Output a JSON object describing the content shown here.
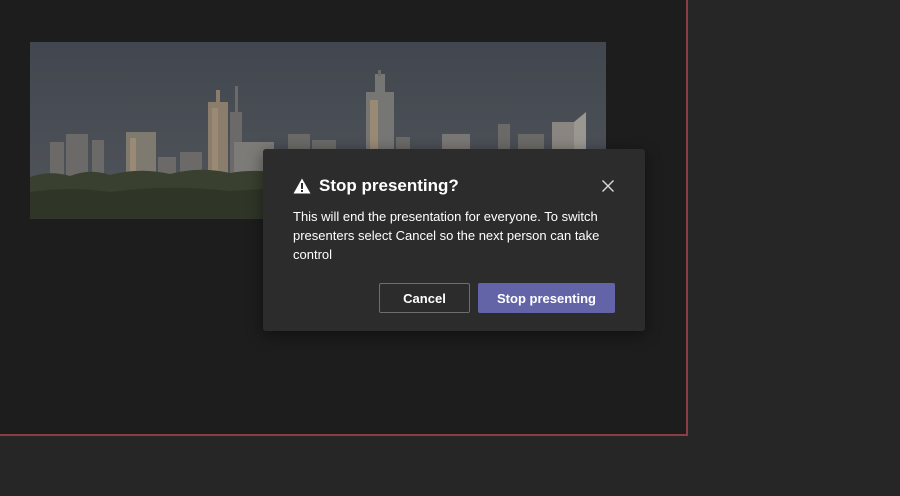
{
  "dialog": {
    "title": "Stop presenting?",
    "message": "This will end the presentation for everyone. To switch presenters select Cancel so the next person can take control",
    "cancel_label": "Cancel",
    "confirm_label": "Stop presenting",
    "icons": {
      "warning": "warning-icon",
      "close": "close-icon"
    }
  },
  "colors": {
    "background": "#262626",
    "presentation_border": "#8a3d45",
    "dialog_background": "#2d2c2c",
    "primary_button": "#6264a7"
  }
}
